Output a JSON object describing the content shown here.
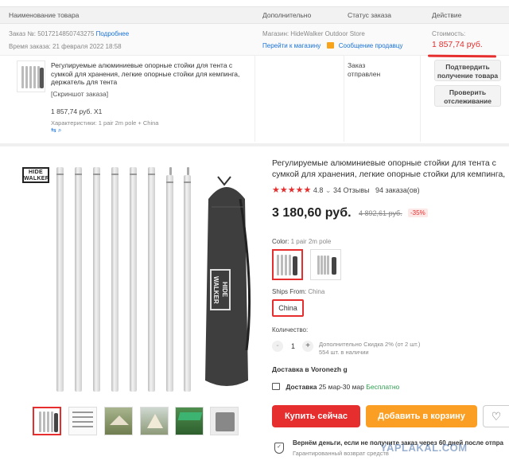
{
  "order": {
    "header": {
      "col_product": "Наименование товара",
      "col_extra": "Дополнительно",
      "col_status": "Статус заказа",
      "col_action": "Действие"
    },
    "info": {
      "order_no_label": "Заказ №: 5017214850743275",
      "more_link": "Подробнее",
      "order_time": "Время заказа: 21 февраля 2022 18:58",
      "store_label": "Магазин: HideWalker Outdoor Store",
      "go_store_link": "Перейти к магазину",
      "message_link": "Сообщение продавцу",
      "cost_label": "Стоимость:",
      "cost_value": "1 857,74 руб."
    },
    "item": {
      "title": "Регулируемые алюминиевые опорные стойки для тента с сумкой для хранения, легкие опорные стойки для кемпинга, держатель для тента",
      "screenshot_tag": "[Скриншот заказа]",
      "price_qty": "1 857,74 руб. X1",
      "specs": "Характеристики: 1 pair 2m pole + China",
      "status": "Заказ отправлен",
      "confirm_button": "Подтвердить получение товара",
      "track_button": "Проверить отслеживание"
    }
  },
  "product": {
    "title": "Регулируемые алюминиевые опорные стойки для тента с сумкой для хранения, легкие опорные стойки для кемпинга, держатель для тента",
    "rating": "4.8",
    "reviews": "34 Отзывы",
    "orders": "94 заказа(ов)",
    "price": "3 180,60 руб.",
    "old_price": "4 892,61 руб.",
    "discount": "-35%",
    "color_label": "Color:",
    "color_value": "1 pair 2m pole",
    "ships_label": "Ships From:",
    "ships_value": "China",
    "ships_option": "China",
    "qty_label": "Количество:",
    "qty_value": "1",
    "qty_minus": "-",
    "qty_plus": "+",
    "extra_discount": "Дополнительно Скидка 2% (от 2 шт.)",
    "stock": "554 шт. в наличии",
    "delivery_to": "Доставка в Voronezh g",
    "delivery_label": "Доставка",
    "delivery_dates": "25 мар-30 мар",
    "delivery_free": "Бесплатно",
    "buy_now": "Купить сейчас",
    "add_to_cart": "Добавить в корзину",
    "guarantee_title": "Вернём деньги, если не получите заказ через 60 дней после отпра",
    "guarantee_sub": "Гарантированный возврат средств",
    "brand_logo": "HIDE WALKER",
    "bag_logo": "HIDE WALKER",
    "watermark": "YAPLAKAL.COM"
  },
  "colors": {
    "accent_red": "#e62e2e",
    "accent_orange": "#fb9f24",
    "link_blue": "#1a73d9"
  }
}
